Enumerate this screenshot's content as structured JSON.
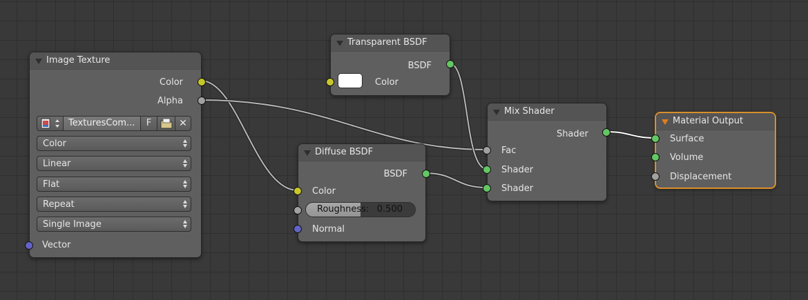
{
  "nodes": {
    "image_texture": {
      "title": "Image Texture",
      "outputs": {
        "color": "Color",
        "alpha": "Alpha"
      },
      "image": {
        "name": "TexturesCom...",
        "fake_user": "F",
        "unlink": "✕"
      },
      "color_space": "Color",
      "interpolation": "Linear",
      "projection": "Flat",
      "extension": "Repeat",
      "source": "Single Image",
      "inputs": {
        "vector": "Vector"
      }
    },
    "transparent_bsdf": {
      "title": "Transparent BSDF",
      "outputs": {
        "bsdf": "BSDF"
      },
      "inputs": {
        "color": "Color"
      },
      "color_value": "#ffffff"
    },
    "diffuse_bsdf": {
      "title": "Diffuse BSDF",
      "outputs": {
        "bsdf": "BSDF"
      },
      "inputs": {
        "color": "Color",
        "roughness_label": "Roughness:",
        "roughness_value": "0.500",
        "normal": "Normal"
      },
      "roughness_fraction": 0.5
    },
    "mix_shader": {
      "title": "Mix Shader",
      "outputs": {
        "shader": "Shader"
      },
      "inputs": {
        "fac": "Fac",
        "shader1": "Shader",
        "shader2": "Shader"
      }
    },
    "material_output": {
      "title": "Material Output",
      "inputs": {
        "surface": "Surface",
        "volume": "Volume",
        "displacement": "Displacement"
      }
    }
  },
  "colors": {
    "socket_color": "#c7c729",
    "socket_float": "#a1a1a1",
    "socket_vector": "#6363c7",
    "socket_shader": "#63c763",
    "active_node_outline": "#f0a030"
  }
}
